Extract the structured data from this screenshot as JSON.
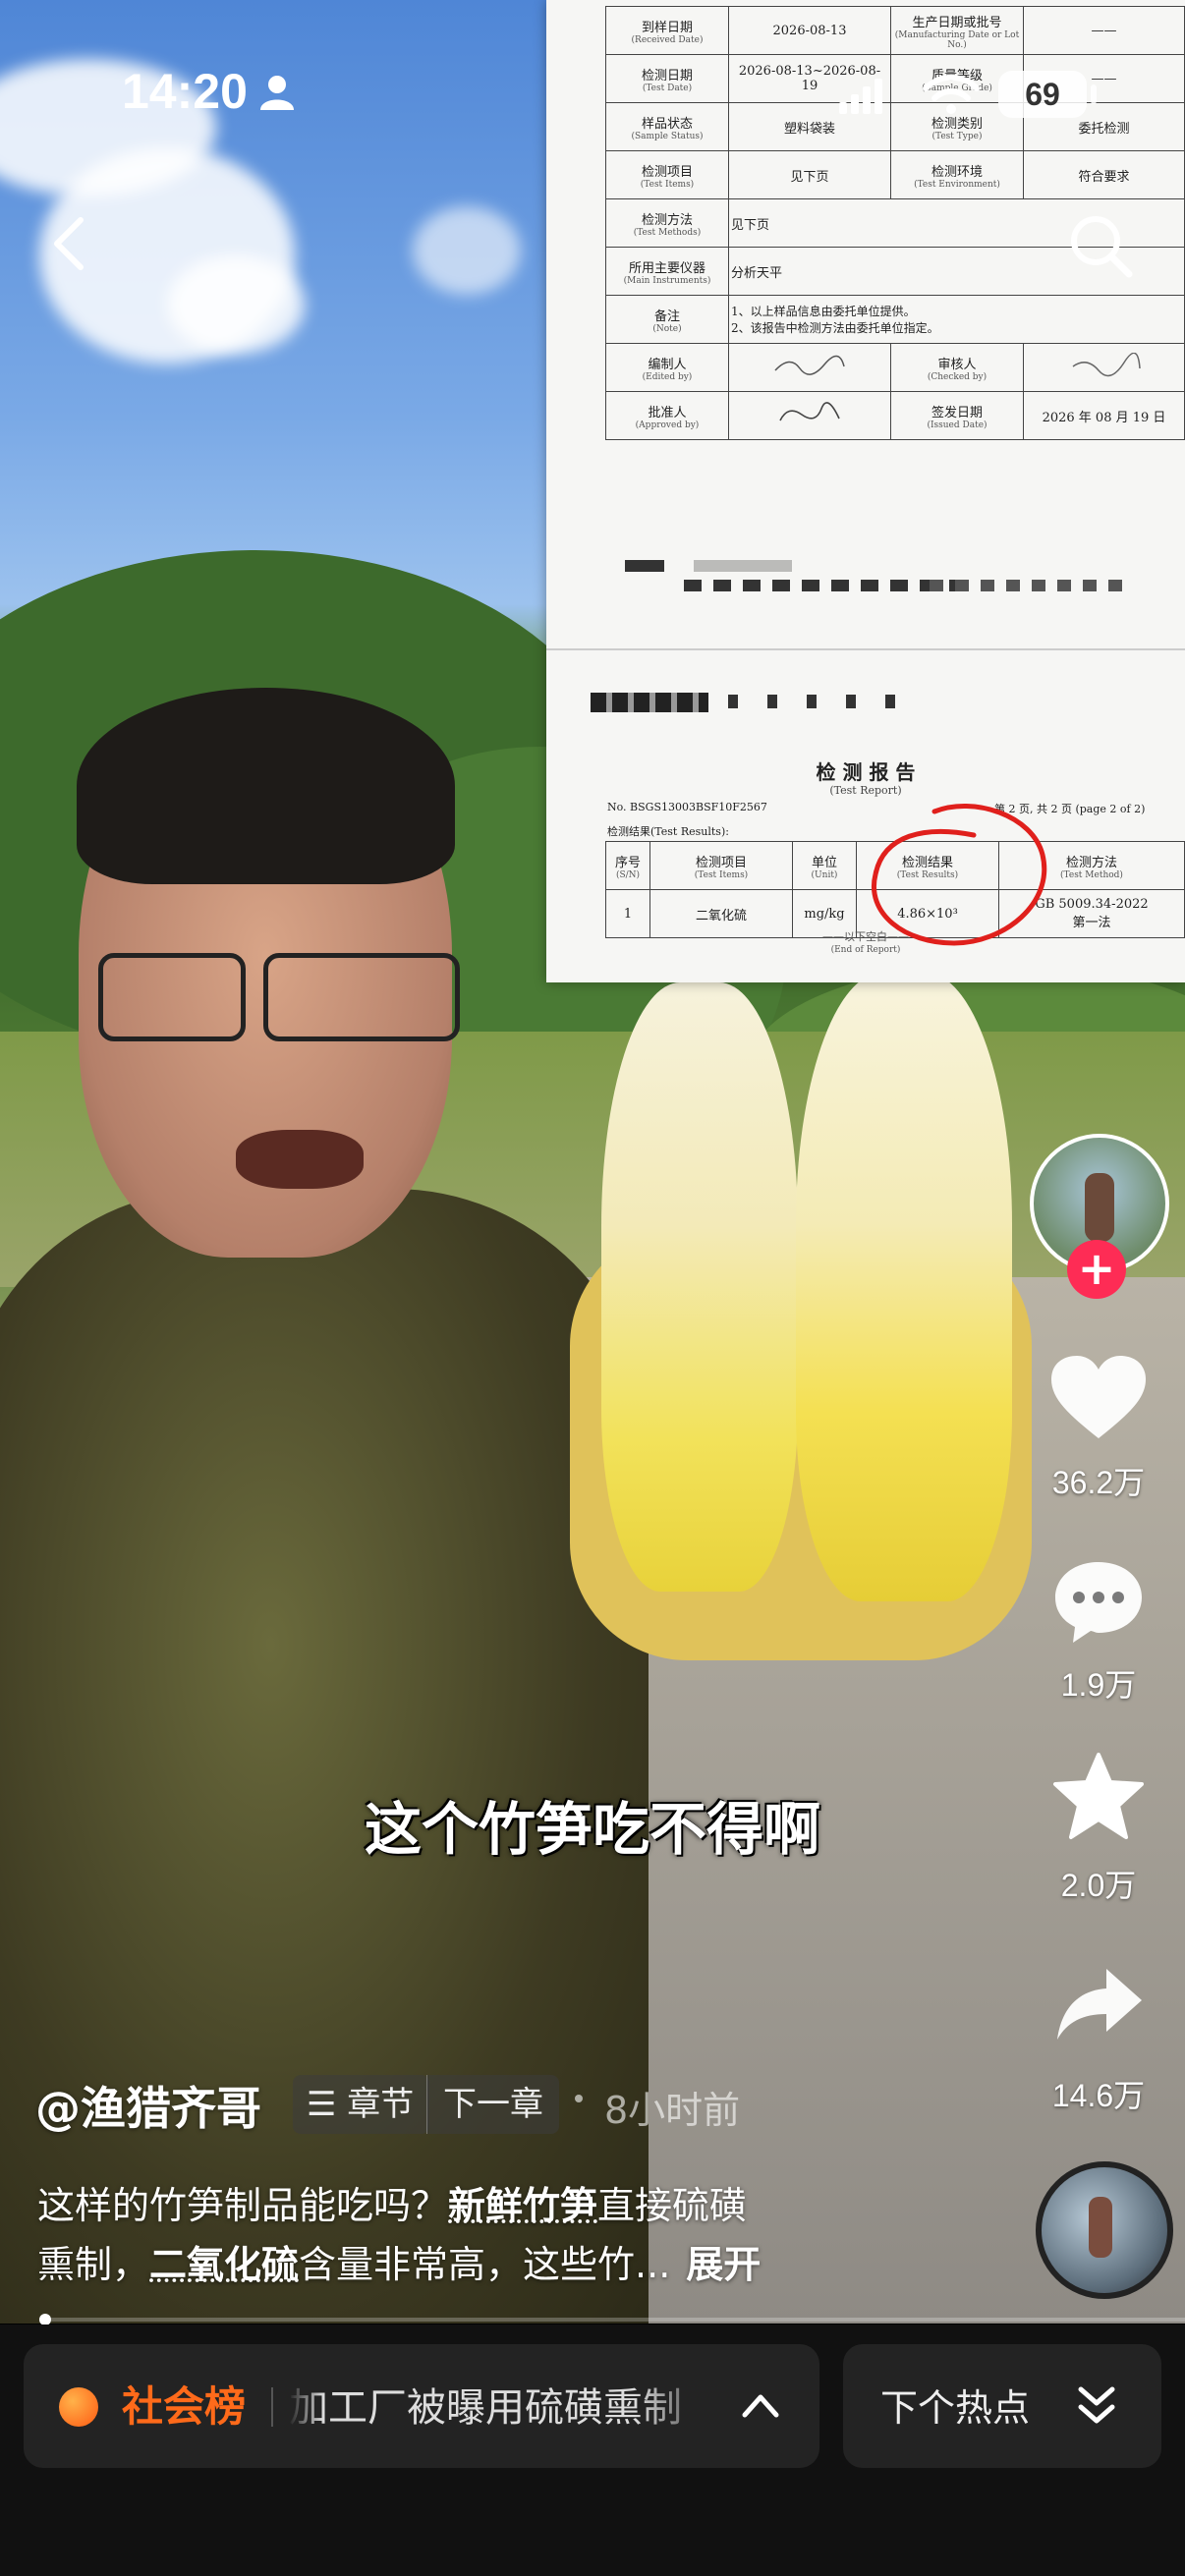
{
  "status_bar": {
    "time": "14:20",
    "battery": "69"
  },
  "video": {
    "subtitle": "这个竹笋吃不得啊"
  },
  "report": {
    "rows": [
      {
        "label": "到样日期",
        "label_en": "(Received Date)",
        "value": "2026-08-13",
        "label2": "生产日期或批号",
        "label2_en": "(Manufacturing Date or Lot No.)",
        "value2": "——"
      },
      {
        "label": "检测日期",
        "label_en": "(Test Date)",
        "value": "2026-08-13~2026-08-19",
        "label2": "质量等级",
        "label2_en": "(Sample Grade)",
        "value2": "——"
      },
      {
        "label": "样品状态",
        "label_en": "(Sample Status)",
        "value": "塑料袋装",
        "label2": "检测类别",
        "label2_en": "(Test Type)",
        "value2": "委托检测"
      },
      {
        "label": "检测项目",
        "label_en": "(Test Items)",
        "value": "见下页",
        "label2": "检测环境",
        "label2_en": "(Test Environment)",
        "value2": "符合要求"
      }
    ],
    "method_label": "检测方法",
    "method_label_en": "(Test Methods)",
    "method_value": "见下页",
    "instr_label": "所用主要仪器",
    "instr_label_en": "(Main Instruments)",
    "instr_value": "分析天平",
    "note_label": "备注",
    "note_label_en": "(Note)",
    "note_1": "1、以上样品信息由委托单位提供。",
    "note_2": "2、该报告中检测方法由委托单位指定。",
    "edit_label": "编制人",
    "edit_label_en": "(Edited by)",
    "check_label": "审核人",
    "check_label_en": "(Checked by)",
    "approve_label": "批准人",
    "approve_label_en": "(Approved by)",
    "issue_label": "签发日期",
    "issue_label_en": "(Issued Date)",
    "issue_date": "2026 年 08 月 19 日",
    "title": "检 测 报 告",
    "title_en": "(Test Report)",
    "report_no": "No. BSGS13003BSF10F2567",
    "page": "第 2 页, 共 2 页 (page 2 of 2)",
    "results_label": "检测结果(Test Results):",
    "headers": [
      {
        "zh": "序号",
        "en": "(S/N)"
      },
      {
        "zh": "检测项目",
        "en": "(Test Items)"
      },
      {
        "zh": "单位",
        "en": "(Unit)"
      },
      {
        "zh": "检测结果",
        "en": "(Test Results)"
      },
      {
        "zh": "检测方法",
        "en": "(Test Method)"
      }
    ],
    "result_row": {
      "sn": "1",
      "item": "二氧化硫",
      "unit": "mg/kg",
      "result": "4.86×10³",
      "method": "GB 5009.34-2022",
      "method2": "第一法"
    },
    "end": "——以下空白——",
    "end_en": "(End of Report)"
  },
  "actions": {
    "likes": "36.2万",
    "comments": "1.9万",
    "favorites": "2.0万",
    "shares": "14.6万"
  },
  "author": {
    "name": "@渔猎齐哥",
    "chapter": "章节",
    "next_chapter": "下一章",
    "time_ago": "8小时前"
  },
  "description": {
    "line1_a": "这样的竹笋制品能吃吗？",
    "line1_b": "新鲜竹笋",
    "line1_c": "直接硫磺",
    "line2_a": "熏制，",
    "line2_b": "二氧化硫",
    "line2_c": "含量非常高，这些竹...",
    "expand": "展开"
  },
  "bottom": {
    "hot_tag": "社会榜",
    "hot_text": "加工厂被曝用硫磺熏制",
    "next_hot": "下个热点"
  },
  "colors": {
    "accent_red": "#fe2c55",
    "hot_orange": "#ff6a1a",
    "underline": "#e6e6e6"
  }
}
